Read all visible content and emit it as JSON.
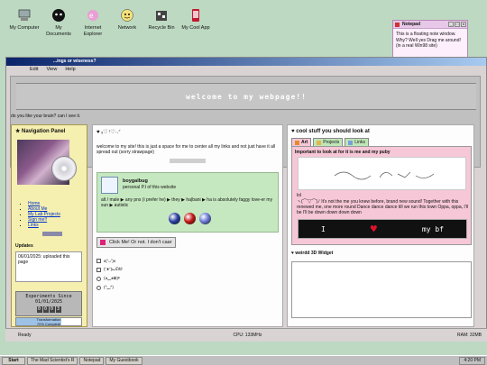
{
  "desktop": {
    "icons": [
      {
        "label": "My Computer",
        "icon": "computer-icon"
      },
      {
        "label": "My\nDocuments",
        "icon": "documents-icon"
      },
      {
        "label": "Internet\nExplorer",
        "icon": "ie-icon"
      },
      {
        "label": "Network",
        "icon": "network-icon"
      },
      {
        "label": "Recycle Bin",
        "icon": "recycle-bin-icon"
      },
      {
        "label": "My Cool App",
        "icon": "app-icon"
      }
    ]
  },
  "notepad": {
    "title": "Notepad",
    "body": "This is a floating note window. Why? Well yes Drag me around! (in a real Win98 site)"
  },
  "window": {
    "title": "...ings or wiseness?",
    "menu": [
      "Edit",
      "View",
      "Help"
    ],
    "banner": "welcome to my webpage!!",
    "question": "do you like your brain? can I see it."
  },
  "nav": {
    "title": "Navigation Panel",
    "links": [
      "Home",
      "About Me",
      "My Lab Projects",
      "Sign me!!",
      "Links"
    ],
    "updates_title": "Updates",
    "updates_text": "06/01/2025: uploaded this page",
    "counter_label": "Experiments Since\n01/01/2025",
    "counter_digits": [
      "0",
      "0",
      "0",
      "3"
    ],
    "progress_label": "Transformation\n70% Complete",
    "progress": 0.7
  },
  "middle": {
    "heading": "♥ ₓ♡ ᵎ♡·.ᐟ",
    "intro": "welcome to my site! this is just a space for me to center all my links and not just have it all spread out (sorry strawpage)",
    "profile_name": "boygalbug",
    "profile_desc": "personal P.I of this website",
    "profile_bio": "alt / male ▶ any pns (i prefer he) ▶ they ▶ ha|bani ▶ ha is absolutely faggy love-er my sun ▶ autistic",
    "orb_colors": [
      "#2c3fa3",
      "#c41818",
      "#6b7ad6"
    ],
    "click_button": "Click Me! Or not. I don't caar",
    "options": [
      {
        "type": "checkbox",
        "label": "ʚ(ˆᴗˆ)ɞ"
      },
      {
        "type": "checkbox",
        "label": "(ᵔᴥᵔ)ᓚᘏᗢ"
      },
      {
        "type": "radio",
        "label": "(◕‿◕✿)ᵎᵎᵎ"
      },
      {
        "type": "radio",
        "label": "(^‿^)"
      }
    ]
  },
  "right": {
    "title": "♥ cool stuff you should look at",
    "tabs": [
      "Art",
      "Projects",
      "Links"
    ],
    "art_heading": "Important to look at for it is me and my puby",
    "lol": "lol",
    "story": "ヽ(⌒▽⌒)ﾉ It's not the me you knew before, brand new sound! Together with this renewed me, one more round Dance dance dance till we run this town Oppa, oppa, I'll be I'll be down down down down",
    "mybf_left": "I",
    "mybf_right": "my bf",
    "widget_title": "♥ weirdd 3D Widget"
  },
  "status": {
    "ready": "Ready",
    "cpu": "CPU: 133MHz",
    "ram": "RAM: 32MB"
  },
  "taskbar": {
    "start": "Start",
    "tasks": [
      "The Mad Scientist's R",
      "Notepad",
      "My Guestbook"
    ],
    "clock": "4:20 PM"
  }
}
